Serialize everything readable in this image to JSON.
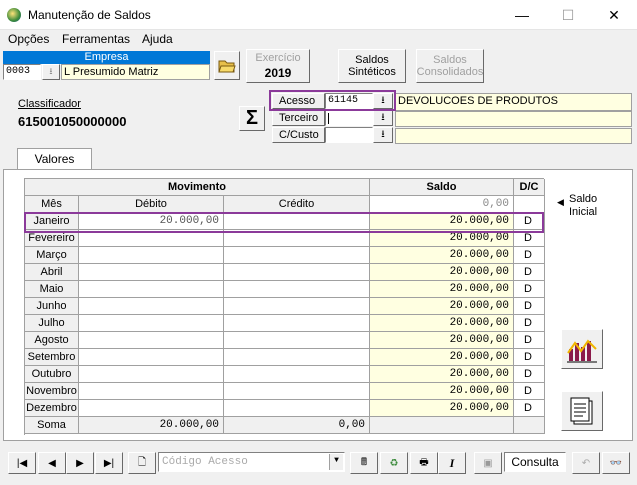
{
  "window": {
    "title": "Manutenção de Saldos",
    "minimize": "—",
    "maximize": "☐",
    "close": "✕"
  },
  "menu": [
    {
      "label": "Opções",
      "u": "O"
    },
    {
      "label": "Ferramentas",
      "u": "F"
    },
    {
      "label": "Ajuda",
      "u": "A"
    }
  ],
  "empresa": {
    "header": "Empresa",
    "code": "0003",
    "name": "L Presumido Matriz"
  },
  "exercicio": {
    "label": "Exercício",
    "year": "2019"
  },
  "buttons": {
    "saldos_sinteticos": [
      "Saldos",
      "Sintéticos"
    ],
    "saldos_consolidados": [
      "Saldos",
      "Consolidados"
    ],
    "consulta": "Consulta"
  },
  "classificador": {
    "label": "Classificador",
    "value": "615001050000000"
  },
  "fields": {
    "acesso_label": "Acesso",
    "acesso_value": "61145",
    "acesso_desc": "DEVOLUCOES DE PRODUTOS",
    "terceiro_label": "Terceiro",
    "ccusto_label": "C/Custo"
  },
  "tab": "Valores",
  "table": {
    "group_header": "Movimento",
    "saldo_header": "Saldo",
    "dc_header": "D/C",
    "col_mes": "Mês",
    "col_debito": "Débito",
    "col_credito": "Crédito",
    "saldo_inicial_value": "0,00",
    "saldo_inicial_label": [
      "Saldo",
      "Inicial"
    ],
    "rows": [
      {
        "mes": "Janeiro",
        "debito": "20.000,00",
        "credito": "",
        "saldo": "20.000,00",
        "dc": "D"
      },
      {
        "mes": "Fevereiro",
        "debito": "",
        "credito": "",
        "saldo": "20.000,00",
        "dc": "D"
      },
      {
        "mes": "Março",
        "debito": "",
        "credito": "",
        "saldo": "20.000,00",
        "dc": "D"
      },
      {
        "mes": "Abril",
        "debito": "",
        "credito": "",
        "saldo": "20.000,00",
        "dc": "D"
      },
      {
        "mes": "Maio",
        "debito": "",
        "credito": "",
        "saldo": "20.000,00",
        "dc": "D"
      },
      {
        "mes": "Junho",
        "debito": "",
        "credito": "",
        "saldo": "20.000,00",
        "dc": "D"
      },
      {
        "mes": "Julho",
        "debito": "",
        "credito": "",
        "saldo": "20.000,00",
        "dc": "D"
      },
      {
        "mes": "Agosto",
        "debito": "",
        "credito": "",
        "saldo": "20.000,00",
        "dc": "D"
      },
      {
        "mes": "Setembro",
        "debito": "",
        "credito": "",
        "saldo": "20.000,00",
        "dc": "D"
      },
      {
        "mes": "Outubro",
        "debito": "",
        "credito": "",
        "saldo": "20.000,00",
        "dc": "D"
      },
      {
        "mes": "Novembro",
        "debito": "",
        "credito": "",
        "saldo": "20.000,00",
        "dc": "D"
      },
      {
        "mes": "Dezembro",
        "debito": "",
        "credito": "",
        "saldo": "20.000,00",
        "dc": "D"
      }
    ],
    "soma": {
      "label": "Soma",
      "debito": "20.000,00",
      "credito": "0,00"
    }
  },
  "footer": {
    "codigo_placeholder": "Código Acesso"
  },
  "colors": {
    "highlight": "#8b3a9a",
    "selected": "#0078d7",
    "yellow": "#ffffe1"
  }
}
